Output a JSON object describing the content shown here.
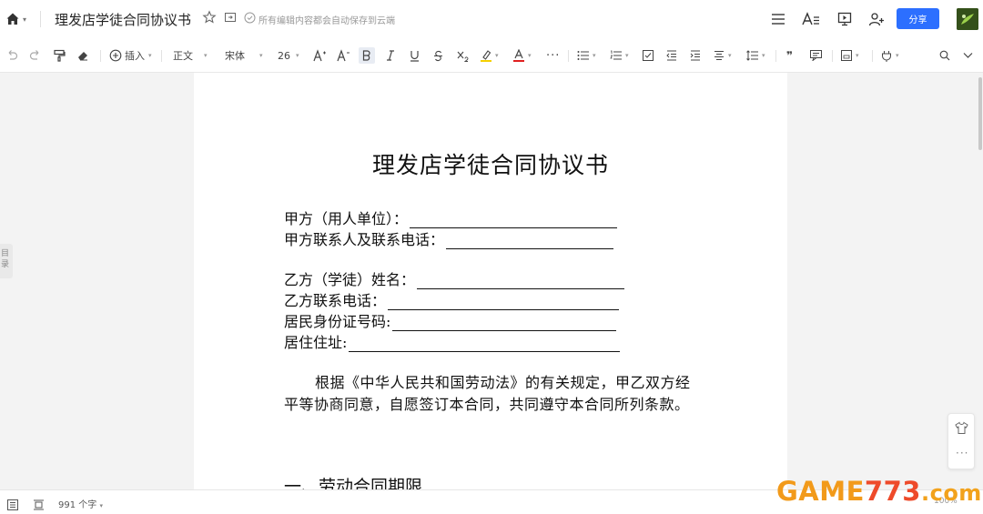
{
  "header": {
    "title": "理发店学徒合同协议书",
    "save_status": "所有编辑内容都会自动保存到云端",
    "share_label": "分享"
  },
  "icons": {
    "home": "home-icon",
    "star": "star-icon",
    "folder": "folder-icon",
    "saved": "cloud-check-icon",
    "menu": "menu-icon",
    "font_style": "font-style-icon",
    "present": "present-icon",
    "add_user": "add-user-icon"
  },
  "toolbar": {
    "insert_label": "插入",
    "style_label": "正文",
    "font_label": "宋体",
    "size_label": "26"
  },
  "sidebar": {
    "catalog_label": "目录"
  },
  "document": {
    "heading": "理发店学徒合同协议书",
    "fields": [
      {
        "label": "甲方（用人单位）："
      },
      {
        "label": "甲方联系人及联系电话："
      },
      {
        "label": "乙方（学徒）姓名："
      },
      {
        "label": "乙方联系电话："
      },
      {
        "label": "居民身份证号码:"
      },
      {
        "label": "居住住址:"
      }
    ],
    "paragraph": "根据《中华人民共和国劳动法》的有关规定，甲乙双方经平等协商同意，自愿签订本合同，共同遵守本合同所列条款。",
    "section_heading": "一、劳动合同期限"
  },
  "status": {
    "word_count": "991 个字",
    "zoom": "100%"
  },
  "watermark": {
    "text": "GAME773.com"
  },
  "colors": {
    "accent": "#2c6fff",
    "font_color_bar": "#e02020",
    "highlight_bar": "#f5d000"
  }
}
